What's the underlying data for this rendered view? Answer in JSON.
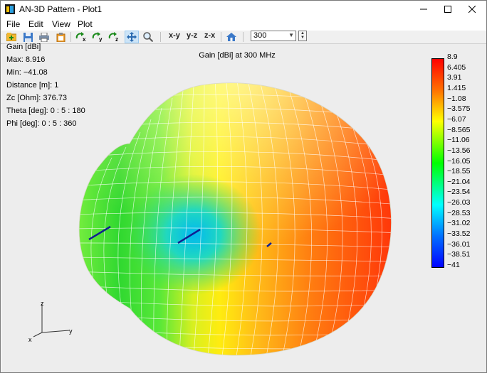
{
  "window": {
    "title": "AN-3D Pattern - Plot1"
  },
  "menu": [
    "File",
    "Edit",
    "View",
    "Plot"
  ],
  "toolbar": {
    "view_xy": "x-y",
    "view_yz": "y-z",
    "view_zx": "z-x",
    "frequency_value": "300",
    "icons": [
      "new-plot-icon",
      "save-icon",
      "print-icon",
      "copy-icon",
      "rotate-x-icon",
      "rotate-y-icon",
      "rotate-z-icon",
      "pan-icon",
      "zoom-icon",
      "home-icon"
    ]
  },
  "plot": {
    "title": "Gain [dBi] at 300 MHz",
    "info": [
      "Gain [dBi]",
      "Max: 8.916",
      "Min: −41.08",
      "Distance [m]: 1",
      "Zc [Ohm]: 376.73",
      "Theta [deg]: 0 : 5 : 180",
      "Phi [deg]: 0 : 5 : 360"
    ],
    "colorbar_labels": [
      "8.9",
      "6.405",
      "3.91",
      "1.415",
      "−1.08",
      "−3.575",
      "−6.07",
      "−8.565",
      "−11.06",
      "−13.56",
      "−16.05",
      "−18.55",
      "−21.04",
      "−23.54",
      "−26.03",
      "−28.53",
      "−31.02",
      "−33.52",
      "−36.01",
      "−38.51",
      "−41"
    ],
    "axes": {
      "z": "z",
      "x": "x",
      "y": "y"
    }
  },
  "colors": {
    "accent": "#0078d7",
    "plot_bg": "#ededed"
  }
}
